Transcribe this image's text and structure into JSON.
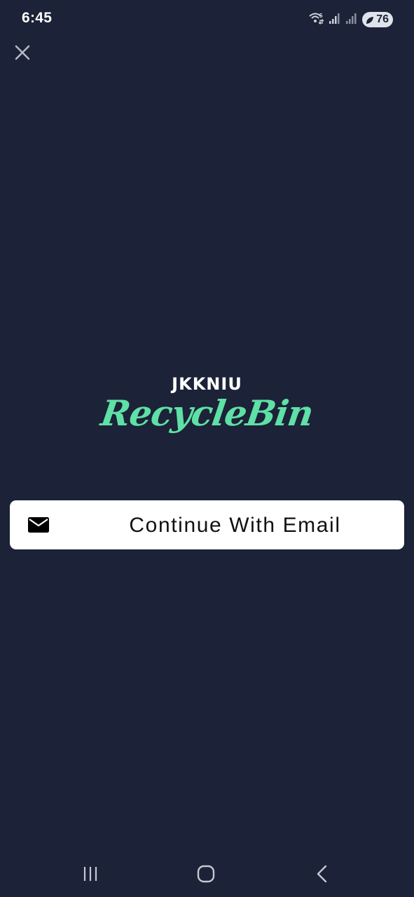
{
  "status_bar": {
    "time": "6:45",
    "wifi_icon": "wifi-icon",
    "signal_icons": [
      "signal-icon",
      "signal-icon"
    ],
    "battery_level": "76"
  },
  "close_icon": "close-icon",
  "logo": {
    "top_text": "JKKNIU",
    "bottom_text": "RecycleBin",
    "accent_color": "#5fe0a6"
  },
  "email_button": {
    "icon": "mail-icon",
    "label": "Continue With Email"
  },
  "nav_bar": {
    "recents_icon": "recents-icon",
    "home_icon": "home-icon",
    "back_icon": "back-icon"
  },
  "colors": {
    "background": "#1c2237",
    "button_background": "#ffffff"
  }
}
